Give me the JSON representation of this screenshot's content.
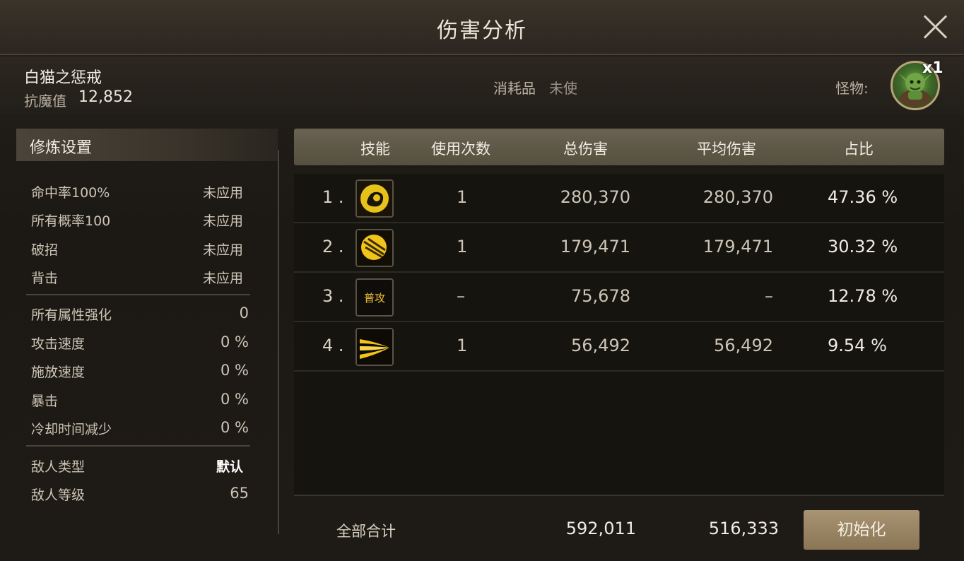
{
  "window": {
    "title": "伤害分析"
  },
  "target": {
    "name": "白猫之惩戒",
    "resist_label": "抗魔值",
    "resist_value": "12,852",
    "consumable_label": "消耗品",
    "consumable_value": "未使",
    "monster_label": "怪物:",
    "monster_count": "x1"
  },
  "settings": {
    "title": "修炼设置",
    "group1": [
      {
        "key": "命中率100%",
        "value": "未应用"
      },
      {
        "key": "所有概率100",
        "value": "未应用"
      },
      {
        "key": "破招",
        "value": "未应用"
      },
      {
        "key": "背击",
        "value": "未应用"
      }
    ],
    "group2": [
      {
        "key": "所有属性强化",
        "value": "0"
      },
      {
        "key": "攻击速度",
        "value": "0 %"
      },
      {
        "key": "施放速度",
        "value": "0 %"
      },
      {
        "key": "暴击",
        "value": "0 %"
      },
      {
        "key": "冷却时间减少",
        "value": "0 %"
      }
    ],
    "group3": [
      {
        "key": "敌人类型",
        "value": "默认"
      },
      {
        "key": "敌人等级",
        "value": "65"
      }
    ]
  },
  "table": {
    "headers": {
      "skill": "技能",
      "uses": "使用次数",
      "total": "总伤害",
      "avg": "平均伤害",
      "ratio": "占比"
    },
    "rows": [
      {
        "rank": "1 .",
        "icon": "fist-skill-icon",
        "uses": "1",
        "total": "280,370",
        "avg": "280,370",
        "ratio": "47.36 %"
      },
      {
        "rank": "2 .",
        "icon": "orb-skill-icon",
        "uses": "1",
        "total": "179,471",
        "avg": "179,471",
        "ratio": "30.32 %"
      },
      {
        "rank": "3 .",
        "icon": "normal-attack-icon",
        "icon_text": "普攻",
        "uses": "–",
        "total": "75,678",
        "avg": "–",
        "ratio": "12.78 %"
      },
      {
        "rank": "4 .",
        "icon": "dash-skill-icon",
        "uses": "1",
        "total": "56,492",
        "avg": "56,492",
        "ratio": "9.54 %"
      }
    ]
  },
  "footer": {
    "total_label": "全部合计",
    "total_sum": "592,011",
    "total_avg": "516,333",
    "reset_label": "初始化"
  },
  "colors": {
    "accent_gold": "#f1c232",
    "button": "#a89472",
    "header_bg": "#6a6152"
  }
}
